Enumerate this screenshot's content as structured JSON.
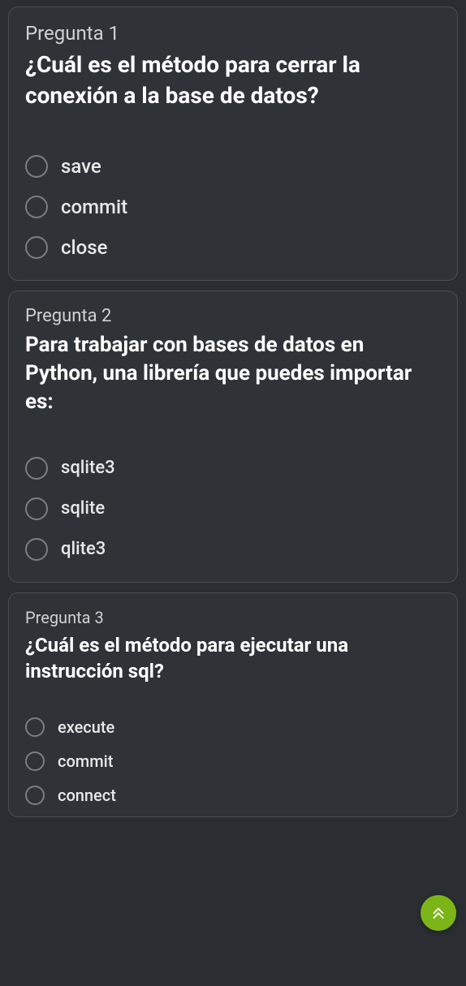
{
  "questions": [
    {
      "number": "Pregunta 1",
      "text": "¿Cuál es el método para cerrar la conexión a la base de datos?",
      "options": [
        "save",
        "commit",
        "close"
      ]
    },
    {
      "number": "Pregunta 2",
      "text": "Para trabajar con bases de datos en Python, una librería que puedes importar es:",
      "options": [
        "sqlite3",
        "sqlite",
        "qlite3"
      ]
    },
    {
      "number": "Pregunta 3",
      "text": "¿Cuál es el método para ejecutar una instrucción sql?",
      "options": [
        "execute",
        "commit",
        "connect"
      ]
    }
  ],
  "scroll_button": {
    "icon": "chevron-double-up"
  }
}
